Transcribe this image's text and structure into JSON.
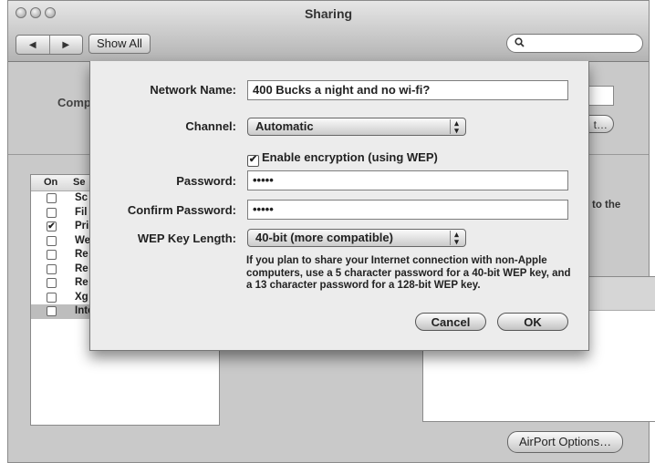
{
  "window": {
    "title": "Sharing",
    "nav_back": "◀",
    "nav_forward": "▶",
    "show_all": "Show All",
    "search_icon": "search-icon"
  },
  "background": {
    "computer_label": "Comp",
    "edit_button": "t…",
    "right_text": "to the",
    "airport_options": "AirPort Options…",
    "service_header": {
      "on": "On",
      "service": "Se"
    },
    "services": [
      {
        "label": "Sc",
        "checked": false
      },
      {
        "label": "Fil",
        "checked": false
      },
      {
        "label": "Pri",
        "checked": true
      },
      {
        "label": "We",
        "checked": false
      },
      {
        "label": "Re",
        "checked": false
      },
      {
        "label": "Re",
        "checked": false
      },
      {
        "label": "Re",
        "checked": false
      },
      {
        "label": "Xg",
        "checked": false
      },
      {
        "label": "Internet Sharing",
        "checked": false
      }
    ]
  },
  "sheet": {
    "network_name_label": "Network Name:",
    "network_name_value": "400 Bucks a night and no wi-fi?",
    "channel_label": "Channel:",
    "channel_value": "Automatic",
    "encryption_label": "Enable encryption (using WEP)",
    "encryption_checked": true,
    "password_label": "Password:",
    "password_value": "•••••",
    "confirm_label": "Confirm Password:",
    "confirm_value": "•••••",
    "wep_length_label": "WEP Key Length:",
    "wep_length_value": "40-bit (more compatible)",
    "help_text": "If you plan to share your Internet connection with non-Apple computers, use a 5 character password for a 40-bit WEP key, and a 13 character password for a 128-bit WEP key.",
    "cancel_label": "Cancel",
    "ok_label": "OK"
  }
}
